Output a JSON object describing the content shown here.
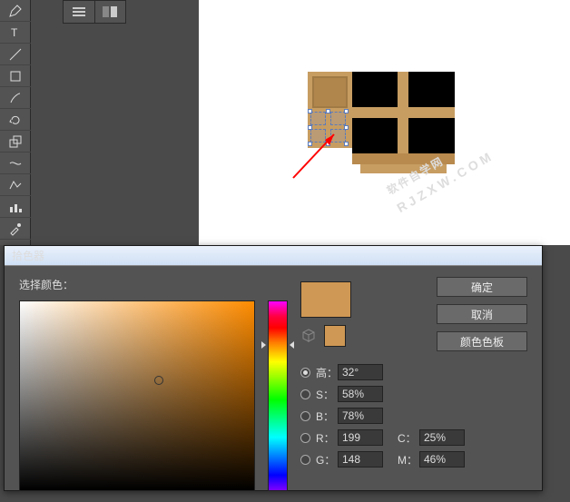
{
  "picker": {
    "title": "拾色器",
    "select_label": "选择颜色：",
    "buttons": {
      "ok": "确定",
      "cancel": "取消",
      "swatches": "颜色色板"
    },
    "fields": {
      "H": {
        "label": "高：",
        "value": "32°"
      },
      "S": {
        "label": "S：",
        "value": "58%"
      },
      "B": {
        "label": "B：",
        "value": "78%"
      },
      "R": {
        "label": "R：",
        "value": "199"
      },
      "G": {
        "label": "G：",
        "value": "148"
      },
      "C": {
        "label": "C：",
        "value": "25%"
      },
      "M": {
        "label": "M：",
        "value": "46%"
      }
    },
    "current_color": "#cf9854"
  },
  "watermark": {
    "main": "软件自学网",
    "sub": "RJZXW.COM"
  }
}
